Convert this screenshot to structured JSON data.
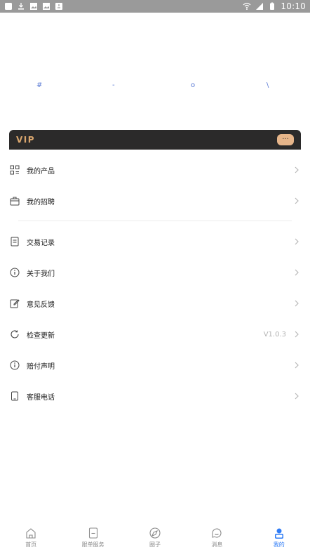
{
  "status_bar": {
    "time": "10:10"
  },
  "placeholders": {
    "g1": "#",
    "g2": "-",
    "g3": "o",
    "g4": "\\"
  },
  "vip": {
    "title": "VIP",
    "button_text": "···"
  },
  "menu": {
    "items": [
      {
        "label": "我的产品",
        "value": ""
      },
      {
        "label": "我的招聘",
        "value": ""
      },
      {
        "label": "交易记录",
        "value": ""
      },
      {
        "label": "关于我们",
        "value": ""
      },
      {
        "label": "意见反馈",
        "value": ""
      },
      {
        "label": "检查更新",
        "value": "V1.0.3"
      },
      {
        "label": "赔付声明",
        "value": ""
      },
      {
        "label": "客服电话",
        "value": ""
      }
    ]
  },
  "bottom_nav": {
    "tabs": [
      {
        "label": "首页"
      },
      {
        "label": "跟单服务"
      },
      {
        "label": "圈子"
      },
      {
        "label": "消息"
      },
      {
        "label": "我的"
      }
    ],
    "active_color": "#2f7cf6",
    "inactive_color": "#8a8a8a"
  },
  "colors": {
    "statusbar_bg": "#9a9a9a",
    "vip_bg": "#2b2a2a",
    "vip_gold": "#d9a66e"
  }
}
